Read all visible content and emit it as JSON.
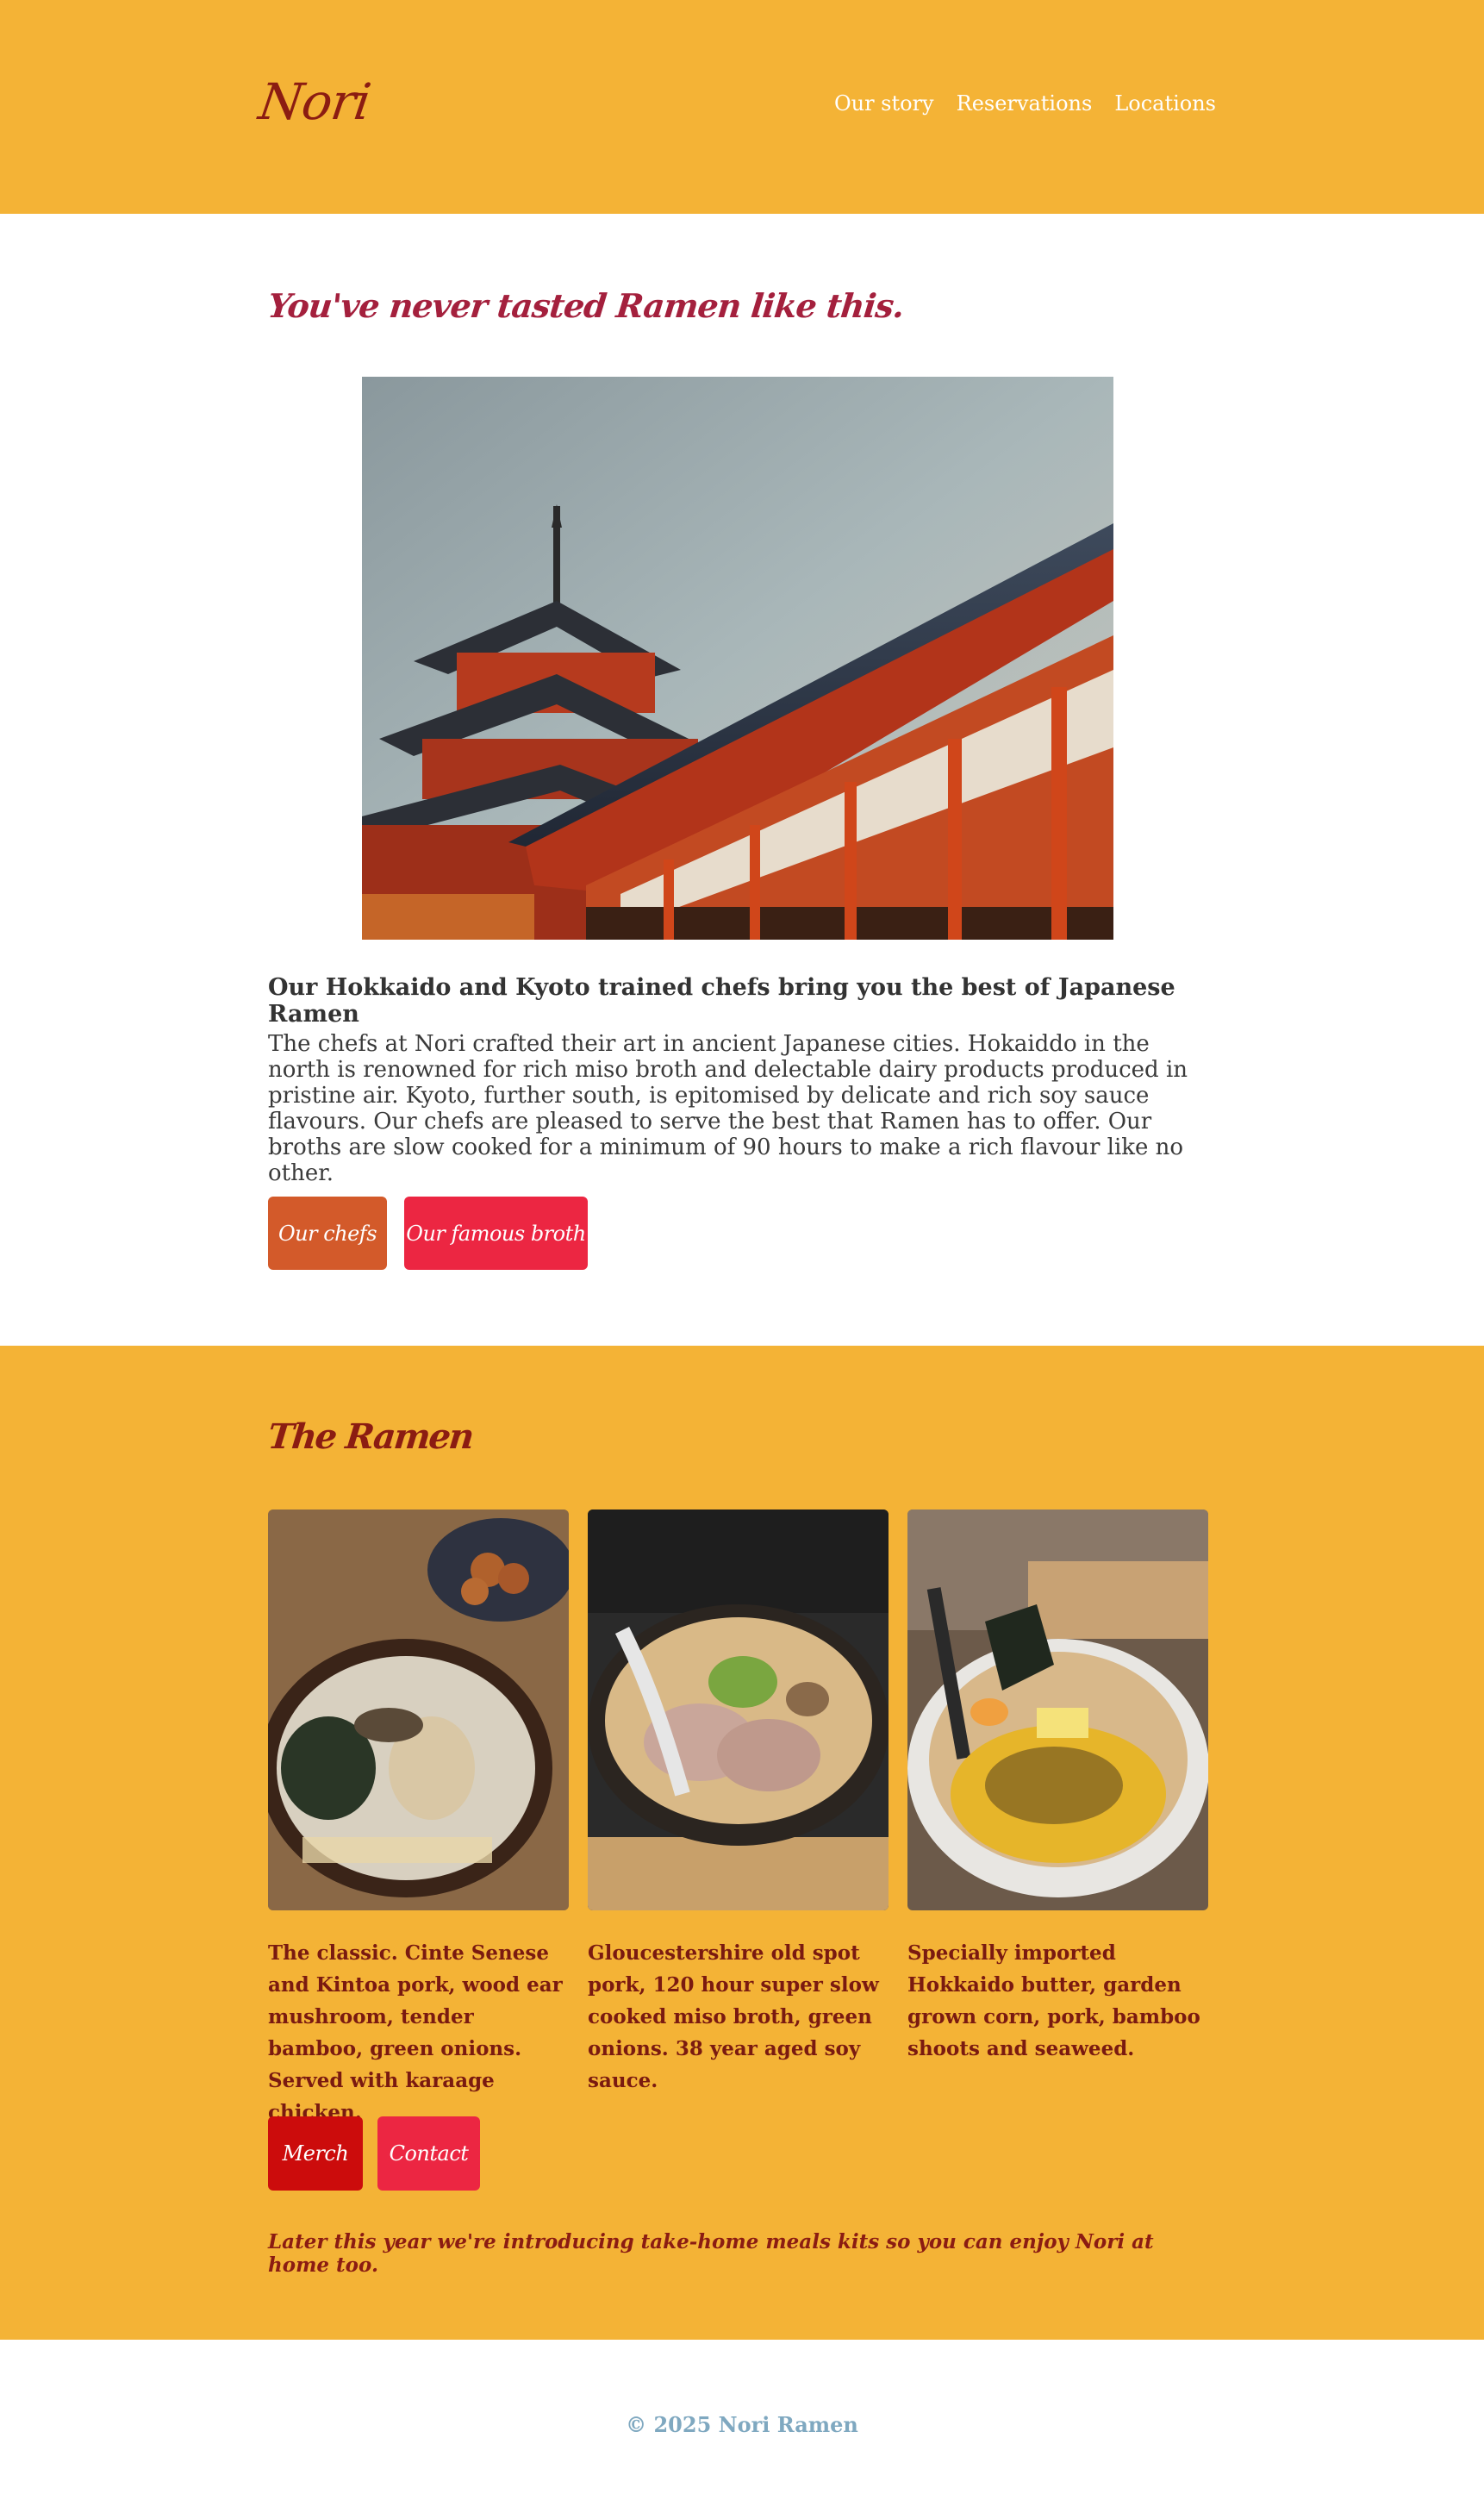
{
  "brand": {
    "logo": "Nori",
    "color_dark_red": "#8b1c12",
    "color_gold": "#f4b336"
  },
  "nav": {
    "items": [
      {
        "label": "Our story"
      },
      {
        "label": "Reservations"
      },
      {
        "label": "Locations"
      }
    ]
  },
  "hero": {
    "tagline": "You've never tasted Ramen like this.",
    "image_alt": "Red Japanese pagoda and temple roof against the sky",
    "subhead": "Our Hokkaido and Kyoto trained chefs bring you the best of Japanese Ramen",
    "body": "The chefs at Nori crafted their art in ancient Japanese cities. Hokaiddo in the north is renowned for rich miso broth and delectable dairy products produced in pristine air. Kyoto, further south, is epitomised by delicate and rich soy sauce flavours. Our chefs are pleased to serve the best that Ramen has to offer. Our broths are slow cooked for a minimum of 90 hours to make a rich flavour like no other.",
    "buttons": {
      "chefs": "Our chefs",
      "broth": "Our famous broth"
    }
  },
  "ramen": {
    "title": "The Ramen",
    "cards": [
      {
        "description": "The classic. Cinte Senese and Kintoa pork, wood ear mushroom, tender bamboo, green onions. Served with karaage chicken."
      },
      {
        "description": "Gloucestershire old spot pork, 120 hour super slow cooked miso broth, green onions. 38 year aged soy sauce."
      },
      {
        "description": "Specially imported Hokkaido butter, garden grown corn, pork, bamboo shoots and seaweed."
      }
    ],
    "buttons": {
      "merch": "Merch",
      "contact": "Contact"
    },
    "promo": "Later this year we're introducing take-home meals kits so you can enjoy Nori at home too."
  },
  "footer": {
    "copyright": "© 2025 Nori Ramen"
  }
}
